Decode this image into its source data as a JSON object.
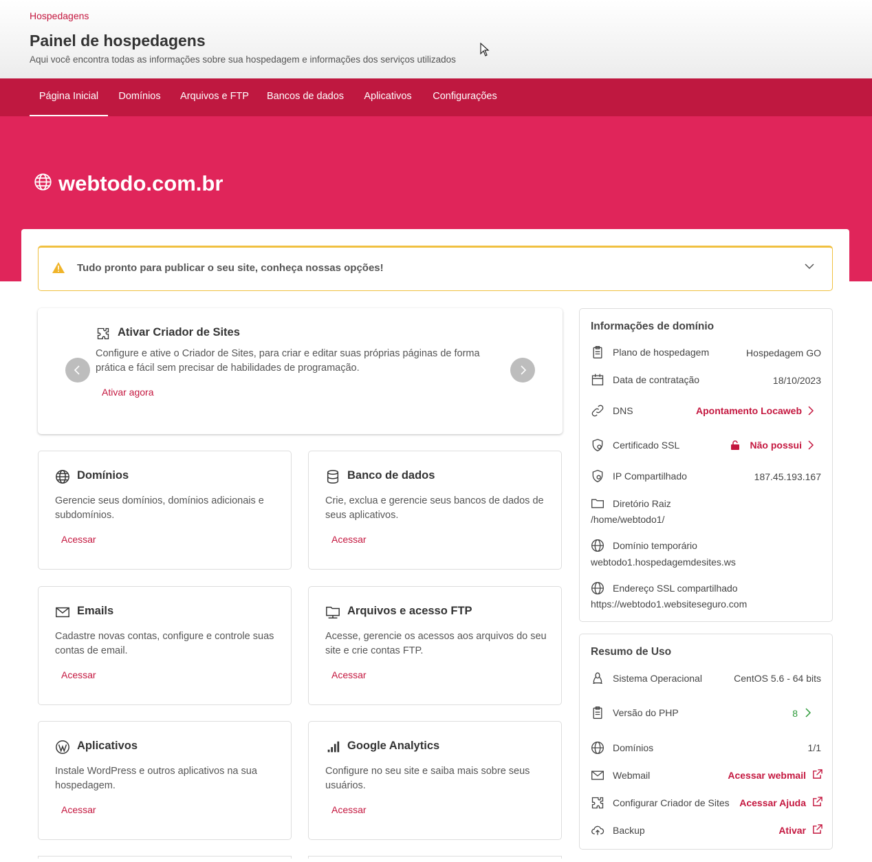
{
  "header": {
    "breadcrumb": "Hospedagens",
    "title": "Painel de hospedagens",
    "subtitle": "Aqui você encontra todas as informações sobre sua hospedagem e informações dos serviços utilizados"
  },
  "nav": {
    "items": [
      {
        "label": "Página Inicial",
        "active": true
      },
      {
        "label": "Domínios"
      },
      {
        "label": "Arquivos e FTP"
      },
      {
        "label": "Bancos de dados"
      },
      {
        "label": "Aplicativos"
      },
      {
        "label": "Configurações"
      }
    ]
  },
  "hero": {
    "domain": "webtodo.com.br"
  },
  "alert": {
    "text": "Tudo pronto para publicar o seu site, conheça nossas opções!"
  },
  "carousel": {
    "title": "Ativar Criador de Sites",
    "description": "Configure e ative o Criador de Sites, para criar e editar suas próprias páginas de forma prática e fácil sem precisar de habilidades de programação.",
    "link": "Ativar agora"
  },
  "cards": [
    {
      "title": "Domínios",
      "description": "Gerencie seus domínios, domínios adicionais e subdomínios.",
      "link": "Acessar",
      "icon": "globe-icon"
    },
    {
      "title": "Banco de dados",
      "description": "Crie, exclua e gerencie seus bancos de dados de seus aplicativos.",
      "link": "Acessar",
      "icon": "database-icon"
    },
    {
      "title": "Emails",
      "description": "Cadastre novas contas, configure e controle suas contas de email.",
      "link": "Acessar",
      "icon": "mail-icon"
    },
    {
      "title": "Arquivos e acesso FTP",
      "description": "Acesse, gerencie os acessos aos arquivos do seu site e crie contas FTP.",
      "link": "Acessar",
      "icon": "folder-network-icon"
    },
    {
      "title": "Aplicativos",
      "description": "Instale WordPress e outros aplicativos na sua hospedagem.",
      "link": "Acessar",
      "icon": "wordpress-icon"
    },
    {
      "title": "Google Analytics",
      "description": "Configure no seu site e saiba mais sobre seus usuários.",
      "link": "Acessar",
      "icon": "analytics-icon"
    }
  ],
  "domain_info": {
    "title": "Informações de domínio",
    "plan_label": "Plano de hospedagem",
    "plan_value": "Hospedagem GO",
    "date_label": "Data de contratação",
    "date_value": "18/10/2023",
    "dns_label": "DNS",
    "dns_value": "Apontamento Locaweb",
    "ssl_label": "Certificado SSL",
    "ssl_value": "Não possui",
    "ip_label": "IP Compartilhado",
    "ip_value": "187.45.193.167",
    "dir_label": "Diretório Raiz",
    "dir_value": "/home/webtodo1/",
    "temp_label": "Domínio temporário",
    "temp_value": "webtodo1.hospedagemdesites.ws",
    "ssl_addr_label": "Endereço SSL compartilhado",
    "ssl_addr_value": "https://webtodo1.websiteseguro.com"
  },
  "usage": {
    "title": "Resumo de Uso",
    "os_label": "Sistema Operacional",
    "os_value": "CentOS 5.6 - 64 bits",
    "php_label": "Versão do PHP",
    "php_value": "8",
    "domains_label": "Domínios",
    "domains_value": "1/1",
    "webmail_label": "Webmail",
    "webmail_value": "Acessar webmail",
    "builder_label": "Configurar Criador de Sites",
    "builder_value": "Acessar Ajuda",
    "backup_label": "Backup",
    "backup_value": "Ativar"
  },
  "colors": {
    "brand": "#e0255a",
    "nav": "#bf1840",
    "link": "#c4173f",
    "warning": "#f0c040",
    "green": "#2e9b3a"
  }
}
